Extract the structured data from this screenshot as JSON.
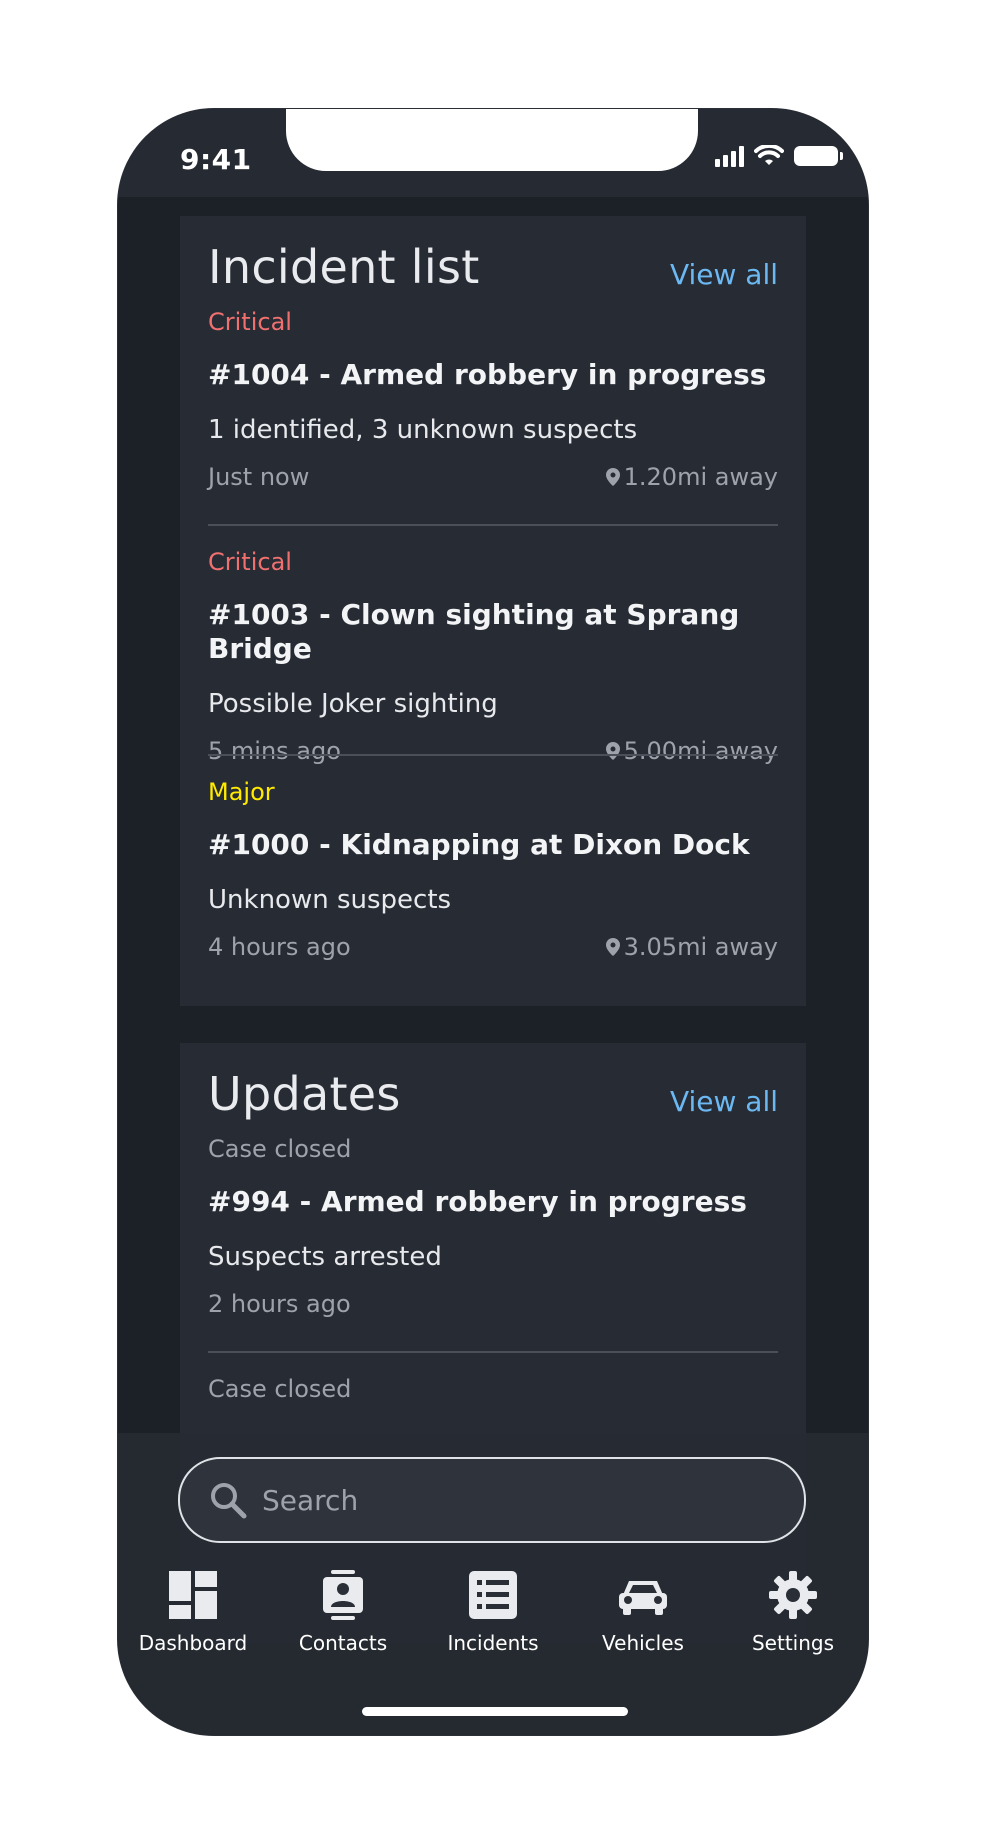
{
  "status_bar": {
    "time": "9:41"
  },
  "incident_list": {
    "title": "Incident list",
    "view_all": "View all",
    "items": [
      {
        "severity": "Critical",
        "title": "#1004 - Armed robbery in progress",
        "description": "1 identified, 3 unknown suspects",
        "time": "Just now",
        "distance": "1.20mi away"
      },
      {
        "severity": "Critical",
        "title": "#1003 - Clown sighting at Sprang Bridge",
        "description": "Possible Joker sighting",
        "time": "5 mins ago",
        "distance": "5.00mi away"
      },
      {
        "severity": "Major",
        "title": "#1000 - Kidnapping at Dixon Dock",
        "description": "Unknown suspects",
        "time": "4 hours ago",
        "distance": "3.05mi away"
      }
    ]
  },
  "updates": {
    "title": "Updates",
    "view_all": "View all",
    "items": [
      {
        "status": "Case closed",
        "title": "#994 - Armed robbery in progress",
        "description": "Suspects arrested",
        "time": "2 hours ago"
      },
      {
        "status": "Case closed"
      }
    ]
  },
  "search": {
    "placeholder": "Search"
  },
  "tab_bar": {
    "tabs": [
      {
        "label": "Dashboard",
        "icon": "dashboard-icon"
      },
      {
        "label": "Contacts",
        "icon": "contacts-icon"
      },
      {
        "label": "Incidents",
        "icon": "incidents-icon"
      },
      {
        "label": "Vehicles",
        "icon": "car-icon"
      },
      {
        "label": "Settings",
        "icon": "gear-icon"
      }
    ]
  },
  "colors": {
    "critical": "#f07070",
    "major": "#ffea00",
    "link": "#6cb8f2",
    "card": "#272b34",
    "background": "#1c2027"
  }
}
